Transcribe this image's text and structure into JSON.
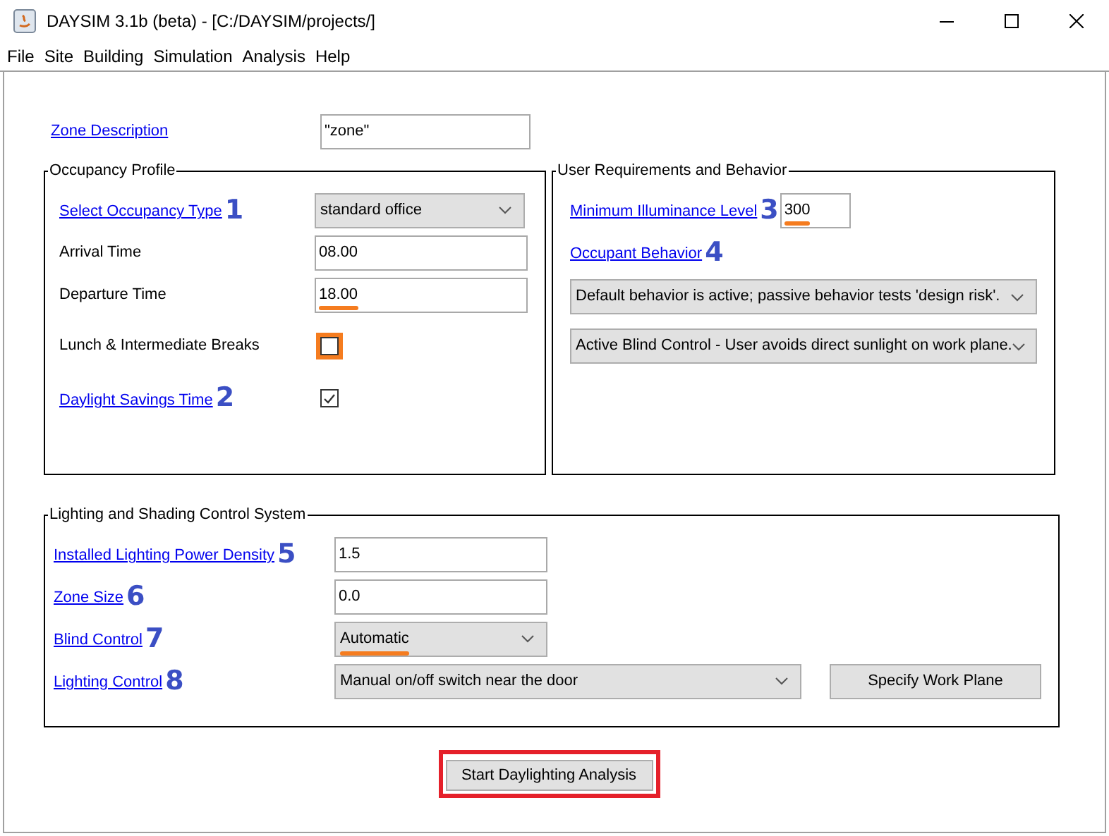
{
  "window": {
    "title": "DAYSIM 3.1b (beta) - [C:/DAYSIM/projects/]"
  },
  "menu": [
    "File",
    "Site",
    "Building",
    "Simulation",
    "Analysis",
    "Help"
  ],
  "zone_description": {
    "label": "Zone Description",
    "value": "\"zone\""
  },
  "occupancy_profile": {
    "title": "Occupancy Profile",
    "rows": [
      {
        "kind": "combo",
        "label": "Select Occupancy Type",
        "link": true,
        "badge": "1",
        "value": "standard office",
        "annotated": false
      },
      {
        "kind": "field",
        "label": "Arrival Time",
        "link": false,
        "value": "08.00",
        "annotated": false
      },
      {
        "kind": "field",
        "label": "Departure Time",
        "link": false,
        "value": "18.00",
        "annotated": true
      },
      {
        "kind": "checkbox",
        "label": "Lunch & Intermediate Breaks",
        "link": false,
        "checked": false,
        "annotated": true
      },
      {
        "kind": "checkbox",
        "label": "Daylight Savings Time",
        "link": true,
        "badge": "2",
        "checked": true,
        "annotated": false
      }
    ]
  },
  "user_requirements": {
    "title": "User Requirements and Behavior",
    "illuminance": {
      "label": "Minimum Illuminance Level",
      "badge": "3",
      "value": "300",
      "annotated": true
    },
    "occupant_behavior": {
      "label": "Occupant Behavior",
      "badge": "4"
    },
    "combos": [
      "Default behavior is active; passive behavior tests 'design risk'.",
      "Active Blind Control - User avoids direct sunlight on work plane."
    ]
  },
  "lighting_shading": {
    "title": "Lighting and Shading Control System",
    "rows": [
      {
        "kind": "field",
        "label": "Installed Lighting Power Density",
        "badge": "5",
        "value": "1.5",
        "annotated": false
      },
      {
        "kind": "field",
        "label": "Zone Size",
        "badge": "6",
        "value": "0.0",
        "annotated": false
      },
      {
        "kind": "combo",
        "label": "Blind Control",
        "badge": "7",
        "value": "Automatic",
        "annotated": true
      },
      {
        "kind": "wide_combo",
        "label": "Lighting Control",
        "badge": "8",
        "value": "Manual on/off switch near the door",
        "annotated": false,
        "button": "Specify Work Plane"
      }
    ]
  },
  "start_button": {
    "label": "Start Daylighting Analysis",
    "annotated": true
  }
}
